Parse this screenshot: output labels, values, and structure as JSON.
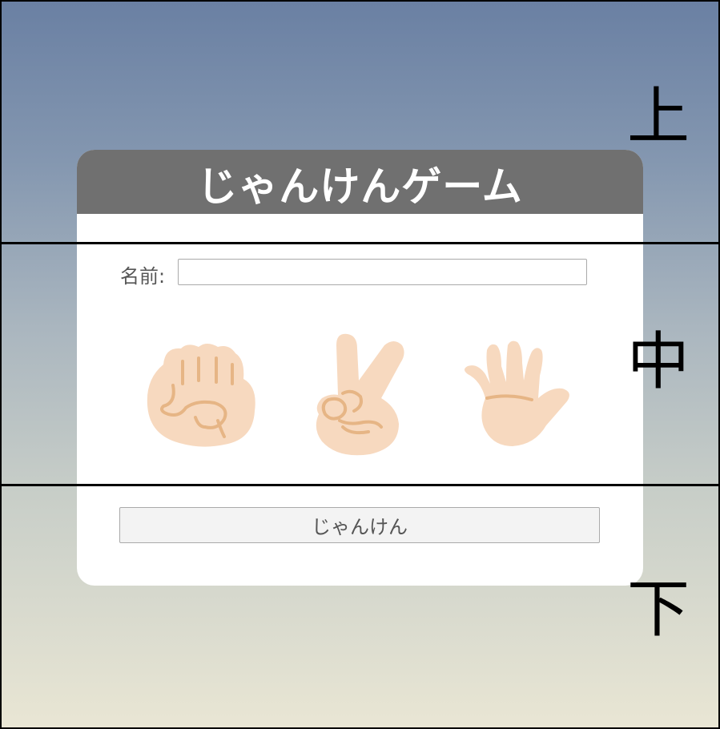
{
  "app": {
    "title": "じゃんけんゲーム"
  },
  "form": {
    "name_label": "名前:",
    "name_value": "",
    "submit_label": "じゃんけん"
  },
  "hands": [
    {
      "name": "rock",
      "icon": "rock-hand-icon"
    },
    {
      "name": "scissors",
      "icon": "scissors-hand-icon"
    },
    {
      "name": "paper",
      "icon": "paper-hand-icon"
    }
  ],
  "regions": {
    "top": "上",
    "middle": "中",
    "bottom": "下"
  },
  "colors": {
    "header": "#707070",
    "skin": "#f7d9bf",
    "skin_line": "#e6b585"
  }
}
